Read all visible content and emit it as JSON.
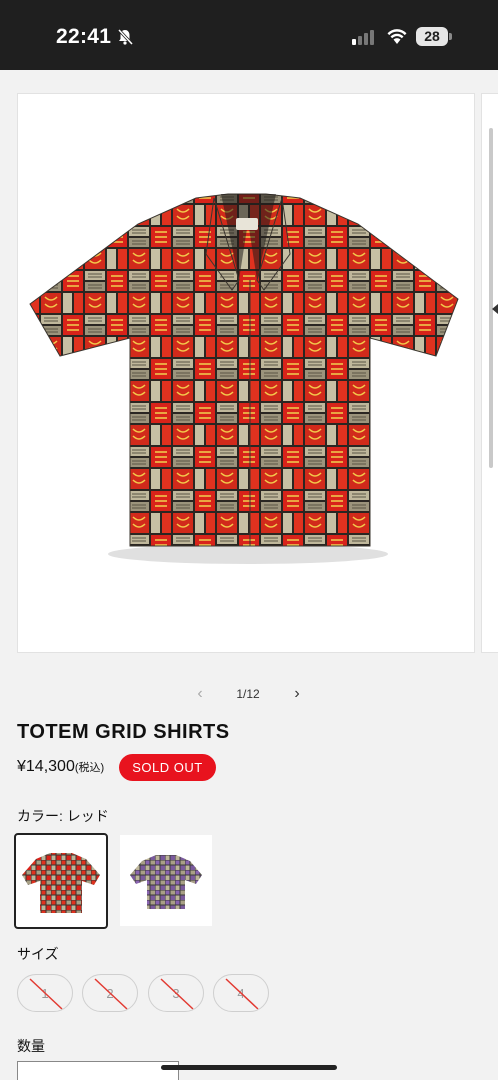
{
  "status_bar": {
    "time": "22:41",
    "battery_level": "28"
  },
  "gallery": {
    "current": "1/12",
    "main_image_alt": "TOTEM GRID SHIRTS red"
  },
  "product": {
    "title": "TOTEM GRID SHIRTS",
    "price": "¥14,300",
    "tax_note": "(税込)",
    "badge": "SOLD OUT"
  },
  "color": {
    "label": "カラー: レッド",
    "swatches": [
      "red",
      "purple"
    ]
  },
  "size": {
    "label": "サイズ",
    "options": [
      "1",
      "2",
      "3",
      "4"
    ]
  },
  "quantity": {
    "label": "数量"
  },
  "colors": {
    "accent": "#e8131e",
    "status_bar": "#1f1f1f",
    "background": "#f2f2f2"
  }
}
